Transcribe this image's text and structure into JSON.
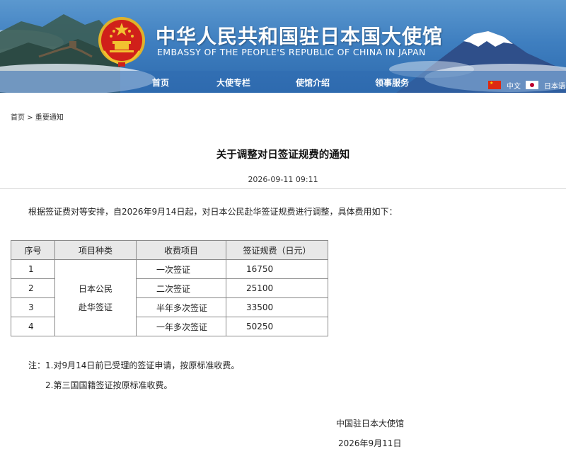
{
  "header": {
    "title_cn": "中华人民共和国驻日本国大使馆",
    "title_en": "EMBASSY OF THE PEOPLE'S REPUBLIC OF CHINA IN JAPAN",
    "nav": [
      "首页",
      "大使专栏",
      "使馆介绍",
      "领事服务"
    ],
    "languages": [
      {
        "label": "中文",
        "flag": "china-flag-icon"
      },
      {
        "label": "日本语",
        "flag": "japan-flag-icon"
      }
    ]
  },
  "breadcrumb": {
    "home": "首页",
    "separator": ">",
    "current": "重要通知"
  },
  "article": {
    "title": "关于调整对日签证规费的通知",
    "date": "2026-09-11 09:11",
    "intro": "根据签证费对等安排，自2026年9月14日起，对日本公民赴华签证规费进行调整，具体费用如下：",
    "table": {
      "headers": [
        "序号",
        "项目种类",
        "收费项目",
        "签证规费（日元）"
      ],
      "category_line1": "日本公民",
      "category_line2": "赴华签证",
      "rows": [
        {
          "no": "1",
          "item": "一次签证",
          "fee": "16750"
        },
        {
          "no": "2",
          "item": "二次签证",
          "fee": "25100"
        },
        {
          "no": "3",
          "item": "半年多次签证",
          "fee": "33500"
        },
        {
          "no": "4",
          "item": "一年多次签证",
          "fee": "50250"
        }
      ]
    },
    "notes": [
      "注：1.对9月14日前已受理的签证申请，按原标准收费。",
      "2.第三国国籍签证按原标准收费。"
    ],
    "signature": "中国驻日本大使馆",
    "sign_date": "2026年9月11日"
  },
  "colors": {
    "banner_blue": "#3f7fc0",
    "emblem_red": "#d0201a",
    "emblem_gold": "#f2c230",
    "table_header_bg": "#e8e8e8"
  }
}
